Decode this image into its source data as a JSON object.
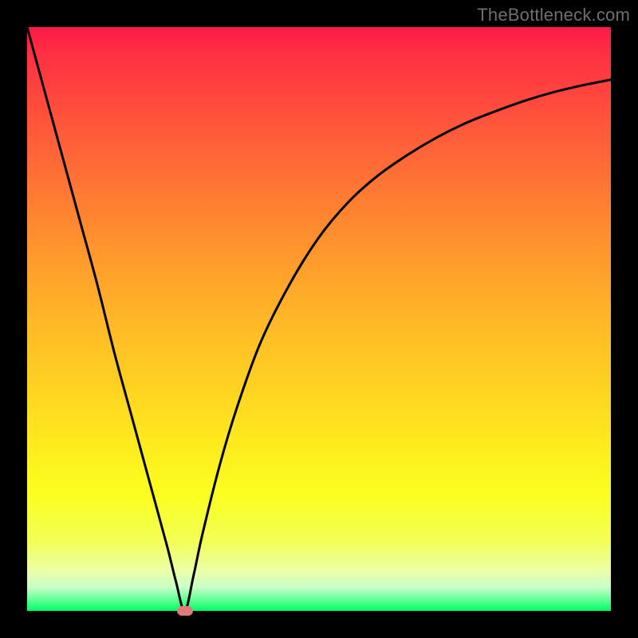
{
  "watermark": "TheBottleneck.com",
  "colors": {
    "frame": "#000000",
    "curve": "#000000",
    "grad_top": "#ff1a4a",
    "grad_bottom": "#00ff66",
    "marker": "#e27a7a",
    "watermark_text": "#6f6f6f"
  },
  "chart_data": {
    "type": "line",
    "title": "",
    "xlabel": "",
    "ylabel": "",
    "xlim": [
      0,
      100
    ],
    "ylim": [
      0,
      100
    ],
    "minimum_x": 27,
    "marker": {
      "x": 27,
      "y": 0
    },
    "series": [
      {
        "name": "bottleneck-curve",
        "x": [
          0,
          3,
          6,
          9,
          12,
          15,
          18,
          21,
          24,
          25.5,
          27,
          28.5,
          30,
          33,
          36,
          40,
          45,
          50,
          55,
          60,
          65,
          70,
          75,
          80,
          85,
          90,
          95,
          100
        ],
        "values": [
          100,
          89,
          78,
          67,
          56,
          44,
          33,
          22,
          11,
          5,
          0,
          6,
          13,
          25,
          35,
          46,
          56,
          64,
          70,
          74.5,
          78,
          81,
          83.5,
          85.5,
          87.3,
          88.8,
          90,
          91
        ]
      }
    ]
  }
}
